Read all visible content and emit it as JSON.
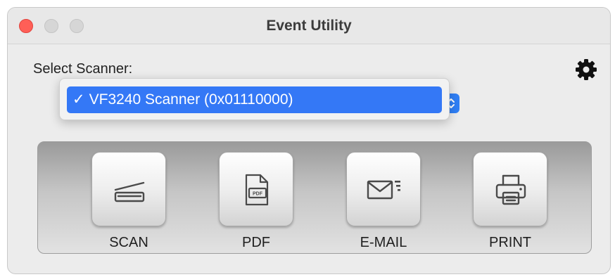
{
  "window": {
    "title": "Event Utility",
    "colors": {
      "close": "#ff5f57",
      "inactive": "#d6d6d6"
    }
  },
  "scanner": {
    "label": "Select Scanner:",
    "check_mark": "✓",
    "selected": "VF3240 Scanner (0x01110000)",
    "options": [
      "VF3240 Scanner (0x01110000)"
    ],
    "highlight_color": "#3478f6"
  },
  "settings": {
    "icon": "gear-icon"
  },
  "actions": [
    {
      "label": "SCAN",
      "icon": "scanner-icon"
    },
    {
      "label": "PDF",
      "icon": "pdf-icon"
    },
    {
      "label": "E-MAIL",
      "icon": "email-icon"
    },
    {
      "label": "PRINT",
      "icon": "printer-icon"
    }
  ]
}
